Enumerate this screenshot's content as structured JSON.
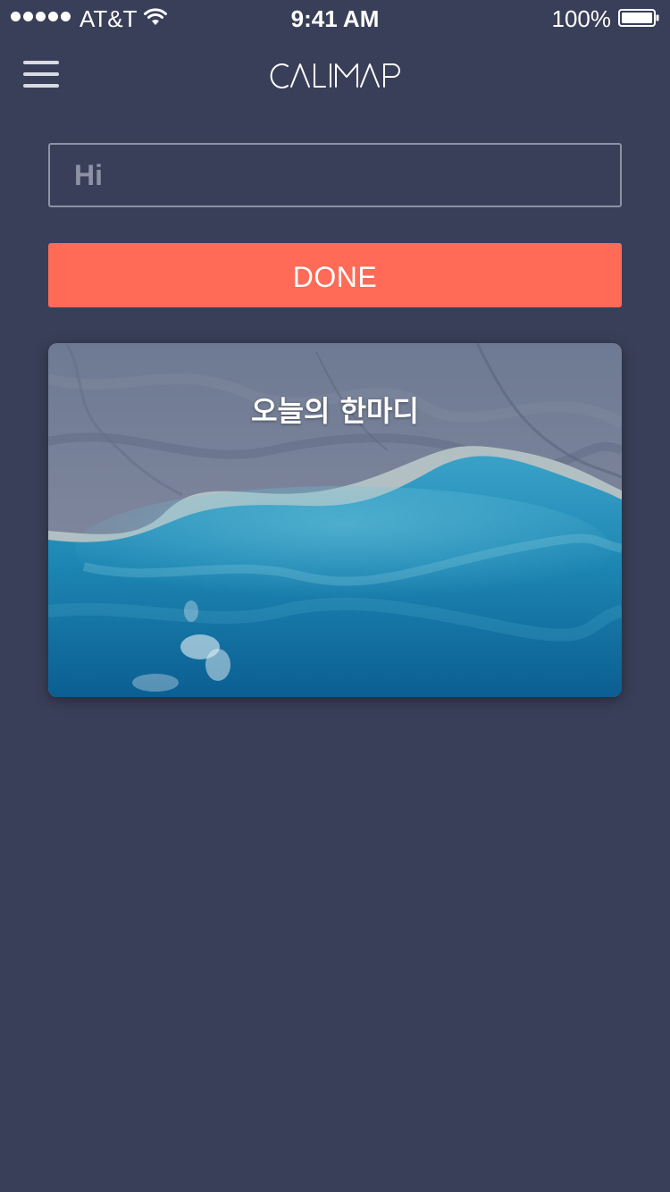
{
  "status_bar": {
    "carrier": "AT&T",
    "time": "9:41 AM",
    "battery": "100%",
    "signal_strength": 5
  },
  "header": {
    "logo": "CALIMAP",
    "menu_icon": "hamburger-menu-icon"
  },
  "form": {
    "input_placeholder": "Hi",
    "input_value": "",
    "done_label": "DONE"
  },
  "card": {
    "title": "오늘의 한마디",
    "background": "aerial coastline photo"
  },
  "colors": {
    "background": "#393f58",
    "accent": "#ff6b57",
    "field_border": "#8d92a6"
  }
}
